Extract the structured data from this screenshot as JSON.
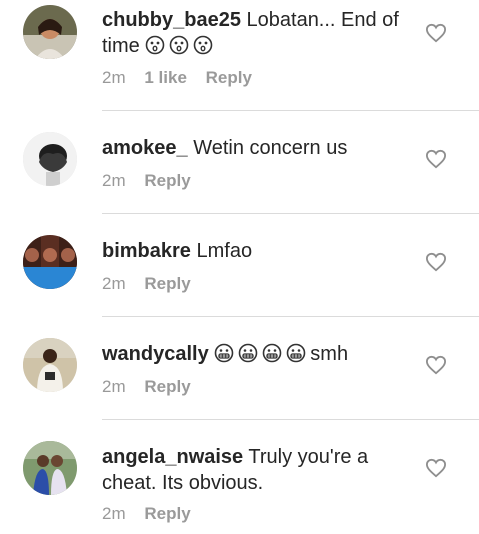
{
  "comments": [
    {
      "username": "chubby_bae25",
      "text": "Lobatan... End of time",
      "emojis_after": [
        "astonished-face",
        "astonished-face",
        "astonished-face"
      ],
      "time": "2m",
      "likes": "1 like",
      "reply": "Reply"
    },
    {
      "username": "amokee_",
      "text": "Wetin concern us",
      "time": "2m",
      "reply": "Reply"
    },
    {
      "username": "bimbakre",
      "text": "Lmfao",
      "time": "2m",
      "reply": "Reply"
    },
    {
      "username": "wandycally",
      "emojis_before": [
        "grimacing-face",
        "grimacing-face",
        "grimacing-face",
        "grimacing-face"
      ],
      "text": "smh",
      "time": "2m",
      "reply": "Reply"
    },
    {
      "username": "angela_nwaise",
      "text": "Truly you're a cheat. Its obvious.",
      "time": "2m",
      "reply": "Reply"
    }
  ],
  "icons": {
    "like": "heart-outline-icon"
  },
  "colors": {
    "text": "#262626",
    "meta": "#999999",
    "divider": "#dbdbdb",
    "heart": "#8e8e8e"
  }
}
